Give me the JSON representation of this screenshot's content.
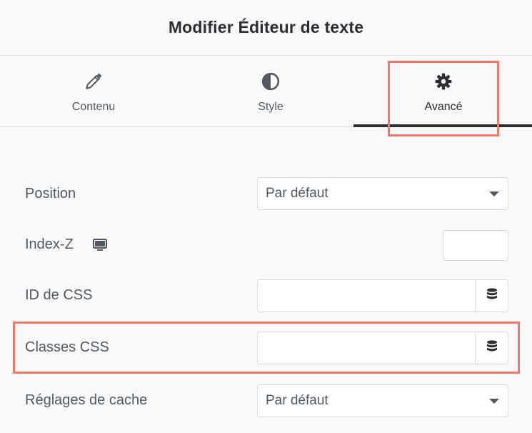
{
  "panel": {
    "title": "Modifier Éditeur de texte"
  },
  "tabs": [
    {
      "label": "Contenu",
      "icon": "pencil-icon"
    },
    {
      "label": "Style",
      "icon": "contrast-icon"
    },
    {
      "label": "Avancé",
      "icon": "gear-icon",
      "active": true
    }
  ],
  "fields": {
    "position": {
      "label": "Position",
      "value": "Par défaut"
    },
    "zindex": {
      "label": "Index-Z",
      "value": "",
      "icon": "desktop-icon"
    },
    "css_id": {
      "label": "ID de CSS",
      "value": "",
      "icon": "database-icon"
    },
    "css_classes": {
      "label": "Classes CSS",
      "value": "",
      "icon": "database-icon"
    },
    "cache": {
      "label": "Réglages de cache",
      "value": "Par défaut"
    }
  },
  "colors": {
    "highlight": "#f07968",
    "active_tab_underline": "#2b2f33"
  }
}
